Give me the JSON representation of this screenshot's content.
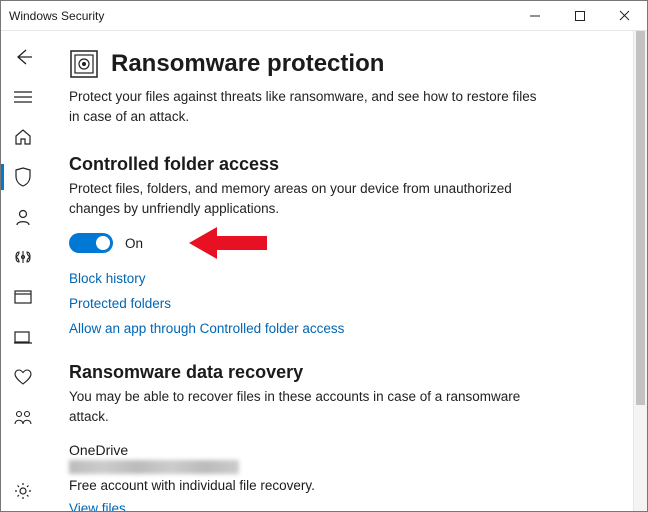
{
  "window": {
    "title": "Windows Security"
  },
  "page": {
    "title": "Ransomware protection",
    "description": "Protect your files against threats like ransomware, and see how to restore files in case of an attack."
  },
  "cfa": {
    "heading": "Controlled folder access",
    "description": "Protect files, folders, and memory areas on your device from unauthorized changes by unfriendly applications.",
    "toggle_state": "On",
    "links": {
      "block_history": "Block history",
      "protected_folders": "Protected folders",
      "allow_app": "Allow an app through Controlled folder access"
    }
  },
  "recovery": {
    "heading": "Ransomware data recovery",
    "description": "You may be able to recover files in these accounts in case of a ransomware attack.",
    "onedrive": {
      "name": "OneDrive",
      "sub": "Free account with individual file recovery.",
      "view_files": "View files"
    }
  },
  "sidebar": {
    "items": [
      {
        "name": "back-icon"
      },
      {
        "name": "menu-icon"
      },
      {
        "name": "home-icon"
      },
      {
        "name": "shield-icon",
        "active": true
      },
      {
        "name": "account-icon"
      },
      {
        "name": "firewall-icon"
      },
      {
        "name": "app-browser-icon"
      },
      {
        "name": "device-security-icon"
      },
      {
        "name": "health-icon"
      },
      {
        "name": "family-icon"
      }
    ],
    "settings": {
      "name": "settings-icon"
    }
  }
}
